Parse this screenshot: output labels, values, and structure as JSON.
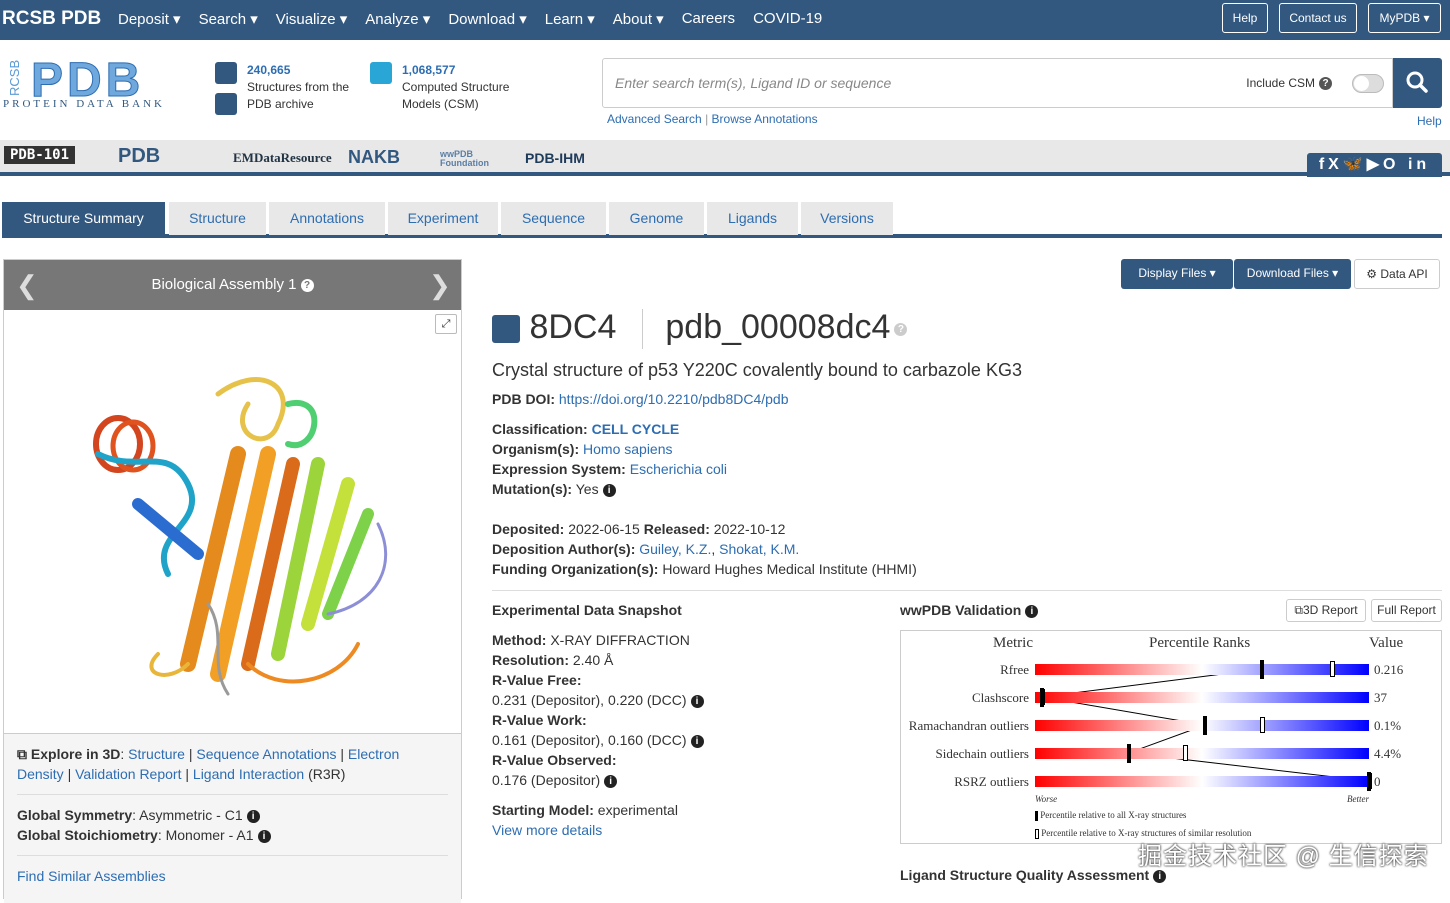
{
  "nav": {
    "brand": "RCSB PDB",
    "menu": [
      "Deposit ▾",
      "Search ▾",
      "Visualize ▾",
      "Analyze ▾",
      "Download ▾",
      "Learn ▾",
      "About ▾",
      "Careers",
      "COVID-19"
    ],
    "help": "Help",
    "contact": "Contact us",
    "mypdb": "MyPDB ▾"
  },
  "header": {
    "logo_sub": "PROTEIN DATA BANK",
    "logo_side": "RCSB",
    "stat1_num": "240,665",
    "stat1_l1": "Structures from the",
    "stat1_l2": "PDB archive",
    "stat2_num": "1,068,577",
    "stat2_l1": "Computed Structure",
    "stat2_l2": "Models (CSM)",
    "search_placeholder": "Enter search term(s), Ligand ID or sequence",
    "include_csm": "Include CSM",
    "advanced": "Advanced Search",
    "browse": "Browse Annotations",
    "help": "Help"
  },
  "partners": [
    "PDB-101",
    "PDB",
    "EMDataResource",
    "NAKB",
    "wwPDB Foundation",
    "PDB-IHM"
  ],
  "social": "fX🦋▶O in",
  "tabs": [
    "Structure Summary",
    "Structure",
    "Annotations",
    "Experiment",
    "Sequence",
    "Genome",
    "Ligands",
    "Versions"
  ],
  "viewer": {
    "title": "Biological Assembly 1",
    "explore_label": "Explore in 3D",
    "links": [
      "Structure",
      "Sequence Annotations",
      "Electron Density",
      "Validation Report",
      "Ligand Interaction"
    ],
    "r3r": "(R3R)",
    "sym_label": "Global Symmetry",
    "sym_val": ": Asymmetric - C1",
    "stoich_label": "Global Stoichiometry",
    "stoich_val": ": Monomer - A1",
    "similar": "Find Similar Assemblies"
  },
  "buttons": {
    "display": "Display Files ▾",
    "download": "Download Files ▾",
    "api": "⚙ Data API"
  },
  "entry": {
    "id": "8DC4",
    "ext_id": "pdb_00008dc4",
    "name": "Crystal structure of p53 Y220C covalently bound to carbazole KG3",
    "doi_label": "PDB DOI:",
    "doi": "https://doi.org/10.2210/pdb8DC4/pdb",
    "class_label": "Classification:",
    "class": "CELL CYCLE",
    "org_label": "Organism(s):",
    "org": "Homo sapiens",
    "expr_label": "Expression System:",
    "expr": "Escherichia coli",
    "mut_label": "Mutation(s):",
    "mut": "Yes",
    "dep_label": "Deposited:",
    "dep": "2022-06-15",
    "rel_label": "Released:",
    "rel": "2022-10-12",
    "auth_label": "Deposition Author(s):",
    "authors": [
      "Guiley, K.Z.",
      "Shokat, K.M."
    ],
    "fund_label": "Funding Organization(s):",
    "fund": "Howard Hughes Medical Institute (HHMI)"
  },
  "experiment": {
    "title": "Experimental Data Snapshot",
    "method_label": "Method:",
    "method": "X-RAY DIFFRACTION",
    "res_label": "Resolution:",
    "res": "2.40 Å",
    "rfree_label": "R-Value Free:",
    "rfree": "0.231 (Depositor), 0.220 (DCC)",
    "rwork_label": "R-Value Work:",
    "rwork": "0.161 (Depositor), 0.160 (DCC)",
    "robs_label": "R-Value Observed:",
    "robs": "0.176 (Depositor)",
    "start_label": "Starting Model:",
    "start": "experimental",
    "more": "View more details"
  },
  "validation": {
    "title": "wwPDB Validation",
    "btn3d": "3D Report",
    "full": "Full Report",
    "h_metric": "Metric",
    "h_rank": "Percentile Ranks",
    "h_value": "Value",
    "rows": [
      {
        "label": "Rfree",
        "value": "0.216",
        "all": 0.68,
        "sim": 0.89
      },
      {
        "label": "Clashscore",
        "value": "37",
        "all": 0.02,
        "sim": 0.02
      },
      {
        "label": "Ramachandran outliers",
        "value": "0.1%",
        "all": 0.51,
        "sim": 0.68
      },
      {
        "label": "Sidechain outliers",
        "value": "4.4%",
        "all": 0.28,
        "sim": 0.45
      },
      {
        "label": "RSRZ outliers",
        "value": "0",
        "all": 1.0,
        "sim": 1.0
      }
    ],
    "worse": "Worse",
    "better": "Better",
    "legend1": "Percentile relative to all X-ray structures",
    "legend2": "Percentile relative to X-ray structures of similar resolution",
    "ligand_title": "Ligand Structure Quality Assessment"
  },
  "watermark": "掘金技术社区 @ 生信探索"
}
